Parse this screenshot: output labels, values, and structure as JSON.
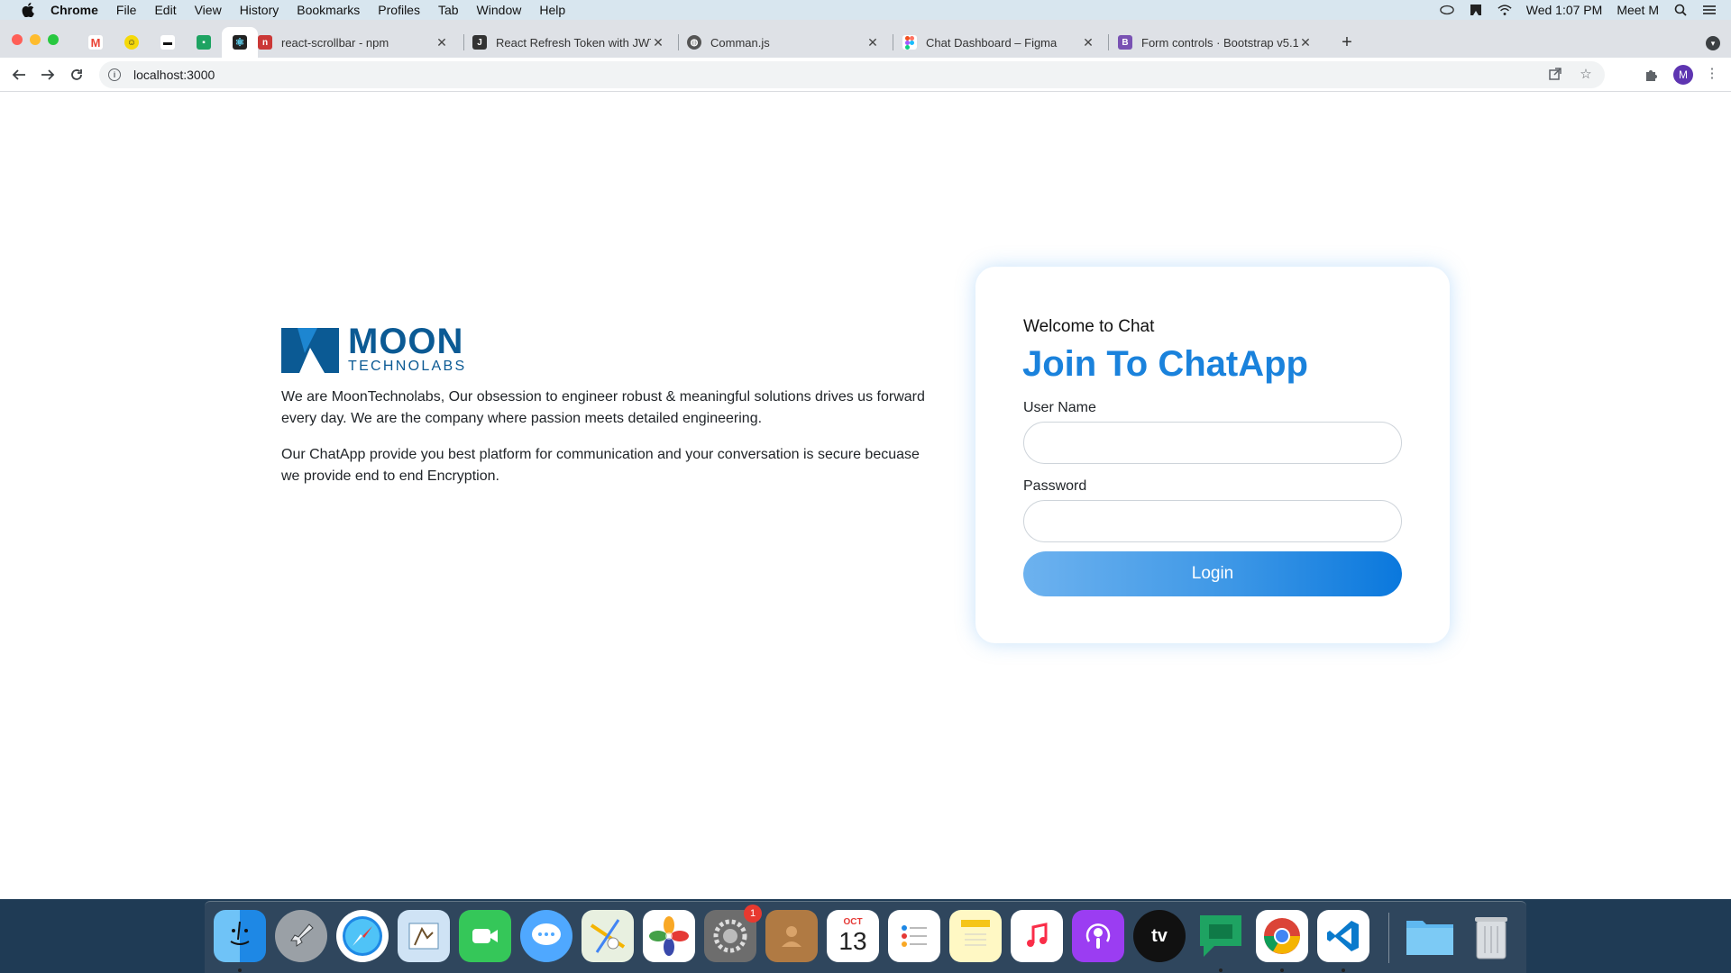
{
  "menubar": {
    "app_name": "Chrome",
    "menus": [
      "File",
      "Edit",
      "View",
      "History",
      "Bookmarks",
      "Profiles",
      "Tab",
      "Window",
      "Help"
    ],
    "clock": "Wed 1:07 PM",
    "user": "Meet M"
  },
  "tabs": [
    {
      "title": "react-scrollbar - npm",
      "favicon": "npm-icon",
      "color": "#cb3837"
    },
    {
      "title": "React Refresh Token with JWT",
      "favicon": "document-icon",
      "color": "#333333"
    },
    {
      "title": "Comman.js",
      "favicon": "globe-icon",
      "color": "#555555"
    },
    {
      "title": "Chat Dashboard – Figma",
      "favicon": "figma-icon",
      "color": "#f24e1e"
    },
    {
      "title": "Form controls · Bootstrap v5.1",
      "favicon": "bootstrap-icon",
      "color": "#7952b3"
    }
  ],
  "address_bar": {
    "url": "localhost:3000"
  },
  "profile_initial": "M",
  "logo": {
    "line1": "MOON",
    "line2": "TECHNOLABS",
    "color": "#0b5a94"
  },
  "about": {
    "paragraph1": "We are MoonTechnolabs, Our obsession to engineer robust & meaningful solutions drives us forward every day. We are the company where passion meets detailed engineering.",
    "paragraph2": "Our ChatApp provide you best platform for communication and your conversation is secure becuase we provide end to end Encryption."
  },
  "login_card": {
    "welcome": "Welcome to Chat",
    "heading": "Join To ChatApp",
    "username_label": "User Name",
    "username_value": "",
    "password_label": "Password",
    "password_value": "",
    "login_button": "Login",
    "accent_color": "#1a82dc"
  },
  "dock": {
    "apps": [
      "finder-icon",
      "launchpad-icon",
      "safari-icon",
      "mail-icon",
      "facetime-icon",
      "messages-icon",
      "maps-icon",
      "photos-icon",
      "system-preferences-icon",
      "contacts-icon",
      "calendar-icon",
      "reminders-icon",
      "notes-icon",
      "music-icon",
      "podcasts-icon",
      "apple-tv-icon",
      "google-chat-icon",
      "chrome-icon",
      "vscode-icon",
      "folder-icon",
      "trash-icon"
    ],
    "calendar_month": "OCT",
    "calendar_day": "13",
    "system_preferences_badge": "1",
    "tv_label": "tv"
  }
}
